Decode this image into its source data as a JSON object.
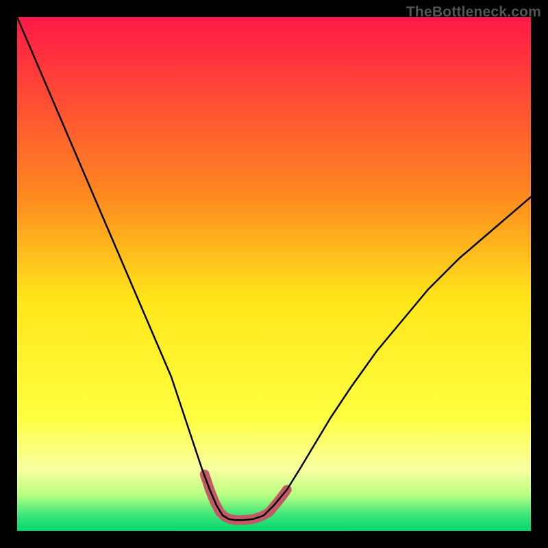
{
  "watermark": "TheBottleneck.com",
  "chart_data": {
    "type": "line",
    "title": "",
    "xlabel": "",
    "ylabel": "",
    "xlim": [
      0,
      100
    ],
    "ylim": [
      0,
      100
    ],
    "grid": false,
    "legend": false,
    "series": [
      {
        "name": "bottleneck-curve",
        "x": [
          0,
          3,
          6,
          9,
          12,
          15,
          18,
          21,
          24,
          27,
          30,
          32,
          34,
          36,
          37.5,
          38.8,
          40,
          41.2,
          42.5,
          44,
          46,
          48,
          50,
          52.5,
          55,
          58,
          61,
          65,
          70,
          75,
          80,
          86,
          93,
          100
        ],
        "y": [
          100,
          93,
          86,
          79,
          72,
          65,
          58,
          51,
          44,
          37,
          30,
          24,
          18,
          12,
          8,
          5,
          3,
          2.3,
          2.1,
          2.1,
          2.3,
          3,
          5,
          8,
          12,
          17,
          22,
          28,
          35,
          41,
          47,
          53,
          59,
          65
        ]
      }
    ],
    "highlight": {
      "name": "valley-highlight",
      "x": [
        36.5,
        37.5,
        38.5,
        39.5,
        40.5,
        41.5,
        42.5,
        43.5,
        44.5,
        46,
        47.5,
        49,
        50.2,
        51.4,
        52.5
      ],
      "y": [
        11,
        8,
        5.5,
        3.6,
        2.7,
        2.3,
        2.1,
        2.1,
        2.15,
        2.3,
        2.8,
        3.6,
        5,
        6.5,
        8
      ]
    },
    "background_gradient": {
      "stops": [
        {
          "offset": 0.0,
          "color": "#ff1846"
        },
        {
          "offset": 0.35,
          "color": "#ff8a1f"
        },
        {
          "offset": 0.55,
          "color": "#ffe61a"
        },
        {
          "offset": 0.78,
          "color": "#ffff40"
        },
        {
          "offset": 0.88,
          "color": "#f8ffa0"
        },
        {
          "offset": 0.93,
          "color": "#b8ff80"
        },
        {
          "offset": 0.965,
          "color": "#48e87a"
        },
        {
          "offset": 1.0,
          "color": "#00d86f"
        }
      ]
    },
    "highlight_color": "#c25a66",
    "curve_color": "#000000"
  }
}
